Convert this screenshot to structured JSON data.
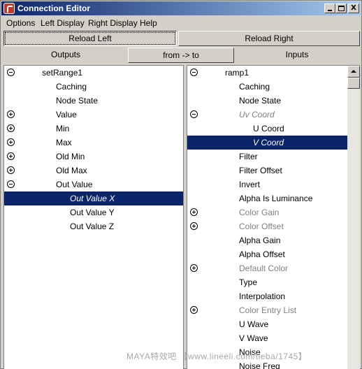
{
  "window": {
    "title": "Connection Editor",
    "controls": {
      "minimize": "_",
      "maximize": "□",
      "close": "X"
    }
  },
  "menu": [
    "Options",
    "Left Display",
    "Right Display",
    "Help"
  ],
  "buttons": {
    "reload_left": "Reload Left",
    "reload_right": "Reload Right"
  },
  "headers": {
    "outputs": "Outputs",
    "direction": "from -> to",
    "inputs": "Inputs"
  },
  "left_panel": {
    "rows": [
      {
        "label": "setRange1",
        "expander": "minus",
        "indent": 1,
        "style": "normal"
      },
      {
        "label": "Caching",
        "expander": "",
        "indent": 2,
        "style": "normal"
      },
      {
        "label": "Node State",
        "expander": "",
        "indent": 2,
        "style": "normal"
      },
      {
        "label": "Value",
        "expander": "plus",
        "indent": 2,
        "style": "normal"
      },
      {
        "label": "Min",
        "expander": "plus",
        "indent": 2,
        "style": "normal"
      },
      {
        "label": "Max",
        "expander": "plus",
        "indent": 2,
        "style": "normal"
      },
      {
        "label": "Old Min",
        "expander": "plus",
        "indent": 2,
        "style": "normal"
      },
      {
        "label": "Old Max",
        "expander": "plus",
        "indent": 2,
        "style": "normal"
      },
      {
        "label": "Out Value",
        "expander": "minus",
        "indent": 2,
        "style": "normal"
      },
      {
        "label": "Out Value X",
        "expander": "",
        "indent": 3,
        "style": "selected"
      },
      {
        "label": "Out Value Y",
        "expander": "",
        "indent": 3,
        "style": "normal"
      },
      {
        "label": "Out Value Z",
        "expander": "",
        "indent": 3,
        "style": "normal"
      }
    ]
  },
  "right_panel": {
    "rows": [
      {
        "label": "ramp1",
        "expander": "minus",
        "indent": 1,
        "style": "normal"
      },
      {
        "label": "Caching",
        "expander": "",
        "indent": 2,
        "style": "normal"
      },
      {
        "label": "Node State",
        "expander": "",
        "indent": 2,
        "style": "normal"
      },
      {
        "label": "Uv Coord",
        "expander": "minus",
        "indent": 2,
        "style": "italic-dim"
      },
      {
        "label": "U Coord",
        "expander": "",
        "indent": 3,
        "style": "normal"
      },
      {
        "label": "V Coord",
        "expander": "",
        "indent": 3,
        "style": "selected"
      },
      {
        "label": "Filter",
        "expander": "",
        "indent": 2,
        "style": "normal"
      },
      {
        "label": "Filter Offset",
        "expander": "",
        "indent": 2,
        "style": "normal"
      },
      {
        "label": "Invert",
        "expander": "",
        "indent": 2,
        "style": "normal"
      },
      {
        "label": "Alpha Is Luminance",
        "expander": "",
        "indent": 2,
        "style": "normal"
      },
      {
        "label": "Color Gain",
        "expander": "plus",
        "indent": 2,
        "style": "dim"
      },
      {
        "label": "Color Offset",
        "expander": "plus",
        "indent": 2,
        "style": "dim"
      },
      {
        "label": "Alpha Gain",
        "expander": "",
        "indent": 2,
        "style": "normal"
      },
      {
        "label": "Alpha Offset",
        "expander": "",
        "indent": 2,
        "style": "normal"
      },
      {
        "label": "Default Color",
        "expander": "plus",
        "indent": 2,
        "style": "dim"
      },
      {
        "label": "Type",
        "expander": "",
        "indent": 2,
        "style": "normal"
      },
      {
        "label": "Interpolation",
        "expander": "",
        "indent": 2,
        "style": "normal"
      },
      {
        "label": "Color Entry List",
        "expander": "plus",
        "indent": 2,
        "style": "dim"
      },
      {
        "label": "U Wave",
        "expander": "",
        "indent": 2,
        "style": "normal"
      },
      {
        "label": "V Wave",
        "expander": "",
        "indent": 2,
        "style": "normal"
      },
      {
        "label": "Noise",
        "expander": "",
        "indent": 2,
        "style": "normal"
      },
      {
        "label": "Noise Freq",
        "expander": "",
        "indent": 2,
        "style": "normal"
      }
    ]
  },
  "watermark": "MAYA特效吧 【www.lineeli.com/tieba/1745】",
  "colors": {
    "selection": "#0a246a",
    "dim_text": "#808080",
    "panel_bg": "#ffffff",
    "chrome": "#d4d0c8"
  }
}
